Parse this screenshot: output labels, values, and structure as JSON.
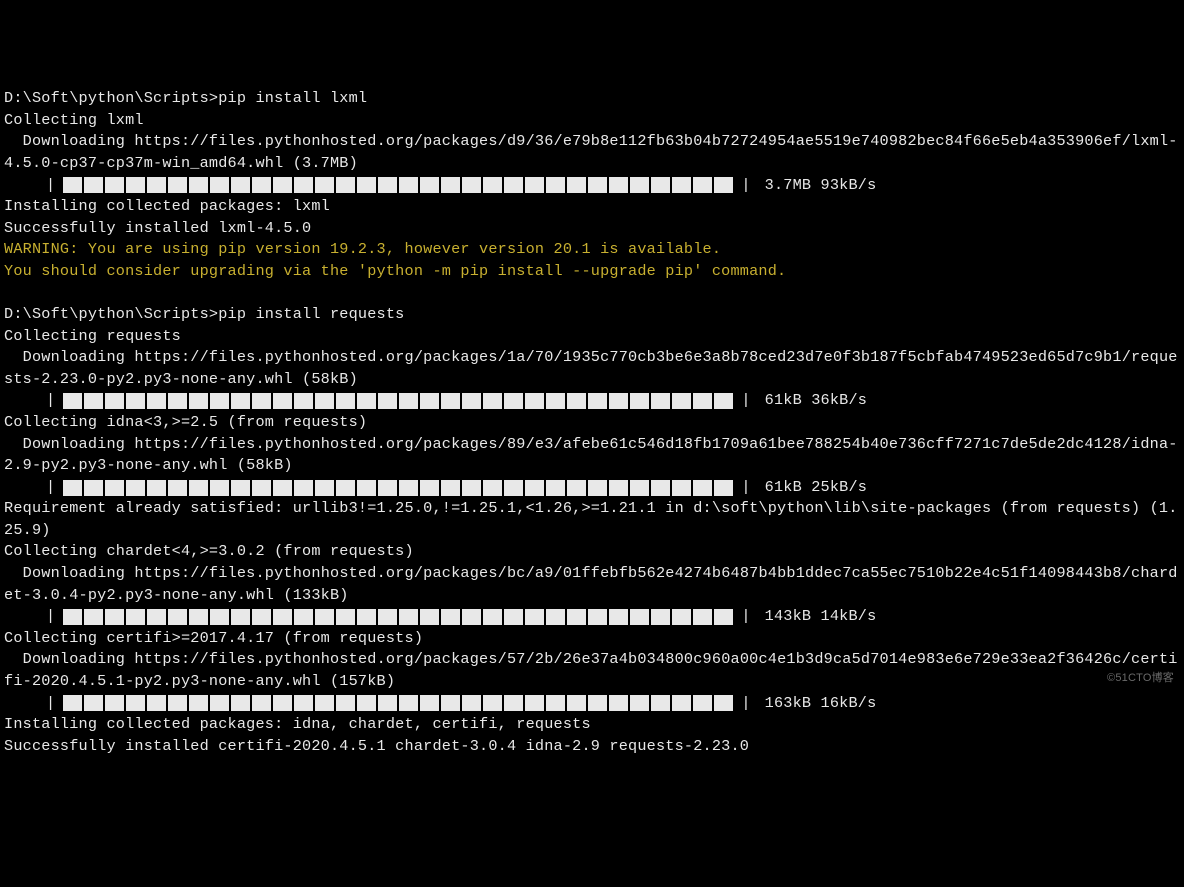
{
  "lines": [
    {
      "type": "text",
      "value": "D:\\Soft\\python\\Scripts>pip install lxml"
    },
    {
      "type": "text",
      "value": "Collecting lxml"
    },
    {
      "type": "text",
      "value": "  Downloading https://files.pythonhosted.org/packages/d9/36/e79b8e112fb63b04b72724954ae5519e740982bec84f66e5eb4a353906ef/lxml-4.5.0-cp37-cp37m-win_amd64.whl (3.7MB)"
    },
    {
      "type": "progress",
      "filled": 32,
      "total": 32,
      "stat": "3.7MB 93kB/s"
    },
    {
      "type": "text",
      "value": "Installing collected packages: lxml"
    },
    {
      "type": "text",
      "value": "Successfully installed lxml-4.5.0"
    },
    {
      "type": "warn",
      "value": "WARNING: You are using pip version 19.2.3, however version 20.1 is available."
    },
    {
      "type": "warn",
      "value": "You should consider upgrading via the 'python -m pip install --upgrade pip' command."
    },
    {
      "type": "text",
      "value": ""
    },
    {
      "type": "text",
      "value": "D:\\Soft\\python\\Scripts>pip install requests"
    },
    {
      "type": "text",
      "value": "Collecting requests"
    },
    {
      "type": "text",
      "value": "  Downloading https://files.pythonhosted.org/packages/1a/70/1935c770cb3be6e3a8b78ced23d7e0f3b187f5cbfab4749523ed65d7c9b1/requests-2.23.0-py2.py3-none-any.whl (58kB)"
    },
    {
      "type": "progress",
      "filled": 32,
      "total": 32,
      "stat": "61kB 36kB/s"
    },
    {
      "type": "text",
      "value": "Collecting idna<3,>=2.5 (from requests)"
    },
    {
      "type": "text",
      "value": "  Downloading https://files.pythonhosted.org/packages/89/e3/afebe61c546d18fb1709a61bee788254b40e736cff7271c7de5de2dc4128/idna-2.9-py2.py3-none-any.whl (58kB)"
    },
    {
      "type": "progress",
      "filled": 32,
      "total": 32,
      "stat": "61kB 25kB/s"
    },
    {
      "type": "text",
      "value": "Requirement already satisfied: urllib3!=1.25.0,!=1.25.1,<1.26,>=1.21.1 in d:\\soft\\python\\lib\\site-packages (from requests) (1.25.9)"
    },
    {
      "type": "text",
      "value": "Collecting chardet<4,>=3.0.2 (from requests)"
    },
    {
      "type": "text",
      "value": "  Downloading https://files.pythonhosted.org/packages/bc/a9/01ffebfb562e4274b6487b4bb1ddec7ca55ec7510b22e4c51f14098443b8/chardet-3.0.4-py2.py3-none-any.whl (133kB)"
    },
    {
      "type": "progress",
      "filled": 32,
      "total": 32,
      "stat": "143kB 14kB/s"
    },
    {
      "type": "text",
      "value": "Collecting certifi>=2017.4.17 (from requests)"
    },
    {
      "type": "text",
      "value": "  Downloading https://files.pythonhosted.org/packages/57/2b/26e37a4b034800c960a00c4e1b3d9ca5d7014e983e6e729e33ea2f36426c/certifi-2020.4.5.1-py2.py3-none-any.whl (157kB)"
    },
    {
      "type": "progress",
      "filled": 32,
      "total": 32,
      "stat": "163kB 16kB/s"
    },
    {
      "type": "text",
      "value": "Installing collected packages: idna, chardet, certifi, requests"
    },
    {
      "type": "text",
      "value": "Successfully installed certifi-2020.4.5.1 chardet-3.0.4 idna-2.9 requests-2.23.0"
    }
  ],
  "watermark": "©51CTO博客"
}
